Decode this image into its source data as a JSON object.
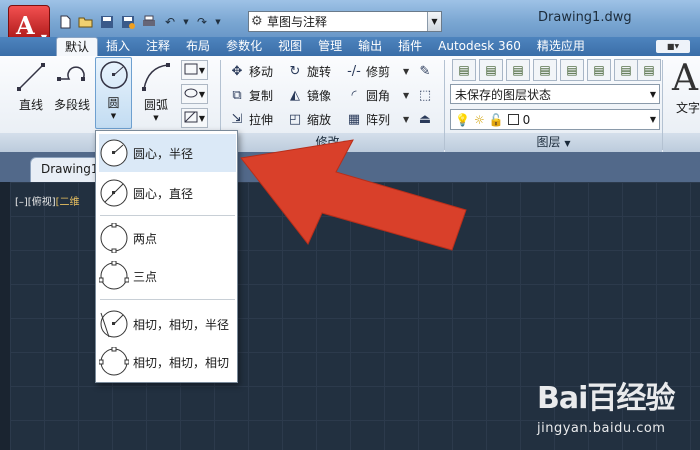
{
  "titlebar": {
    "workspace": "草图与注释",
    "document_title": "Drawing1.dwg",
    "qat_icons": [
      "new-icon",
      "open-icon",
      "save-icon",
      "save-as-icon",
      "print-icon",
      "undo-icon",
      "redo-icon"
    ]
  },
  "ribbon_tabs": [
    "默认",
    "插入",
    "注释",
    "布局",
    "参数化",
    "视图",
    "管理",
    "输出",
    "插件",
    "Autodesk 360",
    "精选应用"
  ],
  "draw_panel": {
    "line": "直线",
    "polyline": "多段线",
    "circle": "圆",
    "arc": "圆弧"
  },
  "modify_panel": {
    "title": "修改",
    "move": "移动",
    "rotate": "旋转",
    "trim": "修剪",
    "copy": "复制",
    "mirror": "镜像",
    "fillet": "圆角",
    "stretch": "拉伸",
    "scale": "缩放",
    "array": "阵列"
  },
  "layers_panel": {
    "title": "图层",
    "layer_state": "未保存的图层状态",
    "current_layer": "0"
  },
  "annotation_panel": {
    "big_glyph": "A",
    "text_label": "文字"
  },
  "doc_tab": "Drawing1",
  "viewport_label": {
    "prefix": "[–][俯视]",
    "style": "[二维"
  },
  "circle_menu": [
    {
      "label": "圆心，半径"
    },
    {
      "label": "圆心，直径"
    },
    {
      "label": "两点"
    },
    {
      "label": "三点"
    },
    {
      "label": "相切，相切，半径"
    },
    {
      "label": "相切，相切，相切"
    }
  ],
  "watermark": {
    "logo": "Bai百经验",
    "site": "jingyan.baidu.com"
  },
  "colors": {
    "arrow": "#d9402a",
    "accent": "#3a6ea8"
  }
}
